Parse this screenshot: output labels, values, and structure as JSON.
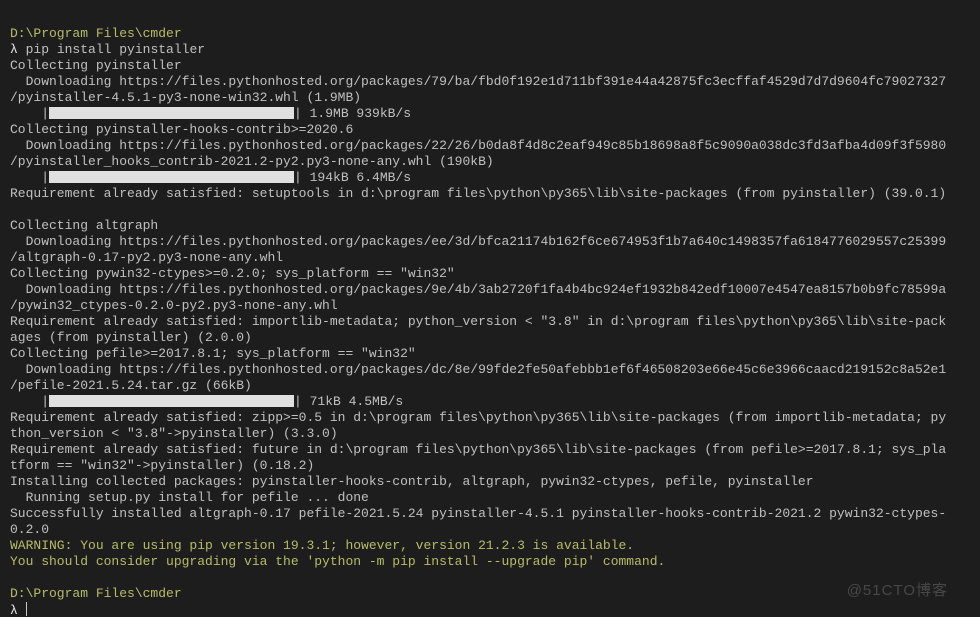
{
  "prompt1": {
    "cwd": "D:\\Program Files\\cmder",
    "symbol": "λ",
    "command": "pip install pyinstaller"
  },
  "lines": {
    "l1": "Collecting pyinstaller",
    "l2": "  Downloading https://files.pythonhosted.org/packages/79/ba/fbd0f192e1d711bf391e44a42875fc3ecffaf4529d7d7d9604fc79027327",
    "l3": "/pyinstaller-4.5.1-py3-none-win32.whl (1.9MB)",
    "l4_pre": "    |",
    "l4_post": "| 1.9MB 939kB/s",
    "l5": "Collecting pyinstaller-hooks-contrib>=2020.6",
    "l6": "  Downloading https://files.pythonhosted.org/packages/22/26/b0da8f4d8c2eaf949c85b18698a8f5c9090a038dc3fd3afba4d09f3f5980",
    "l7": "/pyinstaller_hooks_contrib-2021.2-py2.py3-none-any.whl (190kB)",
    "l8_pre": "    |",
    "l8_post": "| 194kB 6.4MB/s",
    "l9": "Requirement already satisfied: setuptools in d:\\program files\\python\\py365\\lib\\site-packages (from pyinstaller) (39.0.1)",
    "l10": "",
    "l11": "Collecting altgraph",
    "l12": "  Downloading https://files.pythonhosted.org/packages/ee/3d/bfca21174b162f6ce674953f1b7a640c1498357fa6184776029557c25399",
    "l13": "/altgraph-0.17-py2.py3-none-any.whl",
    "l14": "Collecting pywin32-ctypes>=0.2.0; sys_platform == \"win32\"",
    "l15": "  Downloading https://files.pythonhosted.org/packages/9e/4b/3ab2720f1fa4b4bc924ef1932b842edf10007e4547ea8157b0b9fc78599a",
    "l16": "/pywin32_ctypes-0.2.0-py2.py3-none-any.whl",
    "l17": "Requirement already satisfied: importlib-metadata; python_version < \"3.8\" in d:\\program files\\python\\py365\\lib\\site-pack",
    "l18": "ages (from pyinstaller) (2.0.0)",
    "l19": "Collecting pefile>=2017.8.1; sys_platform == \"win32\"",
    "l20": "  Downloading https://files.pythonhosted.org/packages/dc/8e/99fde2fe50afebbb1ef6f46508203e66e45c6e3966caacd219152c8a52e1",
    "l21": "/pefile-2021.5.24.tar.gz (66kB)",
    "l22_pre": "    |",
    "l22_post": "| 71kB 4.5MB/s",
    "l23": "Requirement already satisfied: zipp>=0.5 in d:\\program files\\python\\py365\\lib\\site-packages (from importlib-metadata; py",
    "l24": "thon_version < \"3.8\"->pyinstaller) (3.3.0)",
    "l25": "Requirement already satisfied: future in d:\\program files\\python\\py365\\lib\\site-packages (from pefile>=2017.8.1; sys_pla",
    "l26": "tform == \"win32\"->pyinstaller) (0.18.2)",
    "l27": "Installing collected packages: pyinstaller-hooks-contrib, altgraph, pywin32-ctypes, pefile, pyinstaller",
    "l28": "  Running setup.py install for pefile ... done",
    "l29": "Successfully installed altgraph-0.17 pefile-2021.5.24 pyinstaller-4.5.1 pyinstaller-hooks-contrib-2021.2 pywin32-ctypes-",
    "l30": "0.2.0"
  },
  "warning": {
    "w1": "WARNING: You are using pip version 19.3.1; however, version 21.2.3 is available.",
    "w2": "You should consider upgrading via the 'python -m pip install --upgrade pip' command."
  },
  "prompt2": {
    "cwd": "D:\\Program Files\\cmder",
    "symbol": "λ"
  },
  "progress": {
    "bar1_width": 245,
    "bar2_width": 245,
    "bar3_width": 245
  },
  "watermark": "@51CTO博客"
}
